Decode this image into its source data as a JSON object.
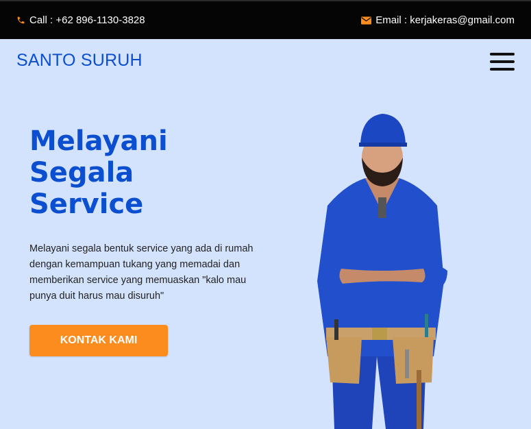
{
  "topbar": {
    "call": "Call : +62 896-1130-3828",
    "email": "Email : kerjakeras@gmail.com"
  },
  "navbar": {
    "brand": "SANTO SURUH"
  },
  "hero": {
    "title_lines": [
      "Melayani",
      "Segala",
      "Service"
    ],
    "description": "Melayani segala bentuk service yang ada di rumah dengan kemampuan tukang yang memadai dan memberikan service yang memuaskan \"kalo mau punya duit harus mau disuruh\"",
    "cta_label": "KONTAK KAMI"
  },
  "colors": {
    "accent": "#fd8c1f",
    "brand": "#0b4fd0",
    "background": "#d3e3fd",
    "topbar": "#050505"
  },
  "icons": {
    "call": "phone-icon",
    "email": "envelope-icon",
    "menu": "hamburger-menu-icon"
  }
}
